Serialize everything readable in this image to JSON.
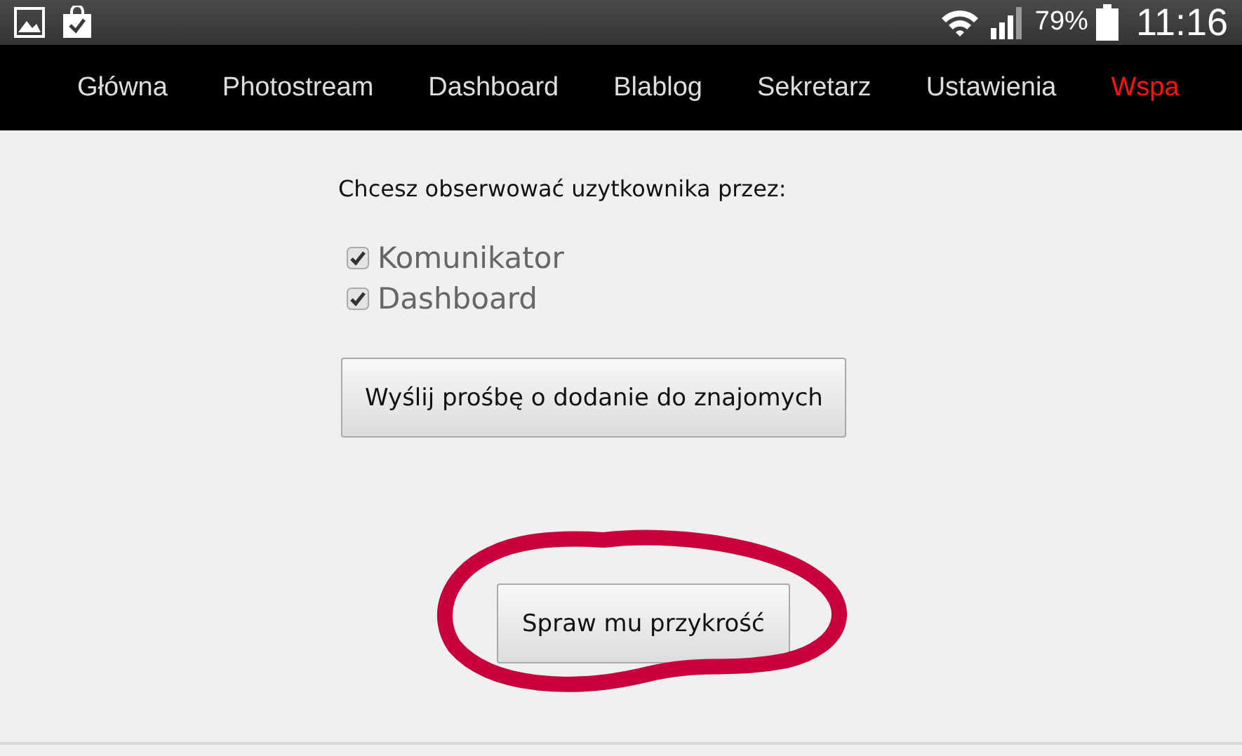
{
  "status_bar": {
    "battery": "79%",
    "time": "11:16"
  },
  "nav": [
    {
      "label": "Główna",
      "selected": false
    },
    {
      "label": "Photostream",
      "selected": false
    },
    {
      "label": "Dashboard",
      "selected": false
    },
    {
      "label": "Blablog",
      "selected": false
    },
    {
      "label": "Sekretarz",
      "selected": false
    },
    {
      "label": "Ustawienia",
      "selected": false
    },
    {
      "label": "Wspa",
      "selected": true
    }
  ],
  "prompt": "Chcesz obserwować uzytkownika przez:",
  "options": [
    {
      "label": "Komunikator",
      "checked": true
    },
    {
      "label": "Dashboard",
      "checked": true
    }
  ],
  "buttons": [
    {
      "label": "Wyślij prośbę o dodanie do znajomych",
      "circled": false
    },
    {
      "label": "Spraw mu przykrość",
      "circled": true
    }
  ]
}
